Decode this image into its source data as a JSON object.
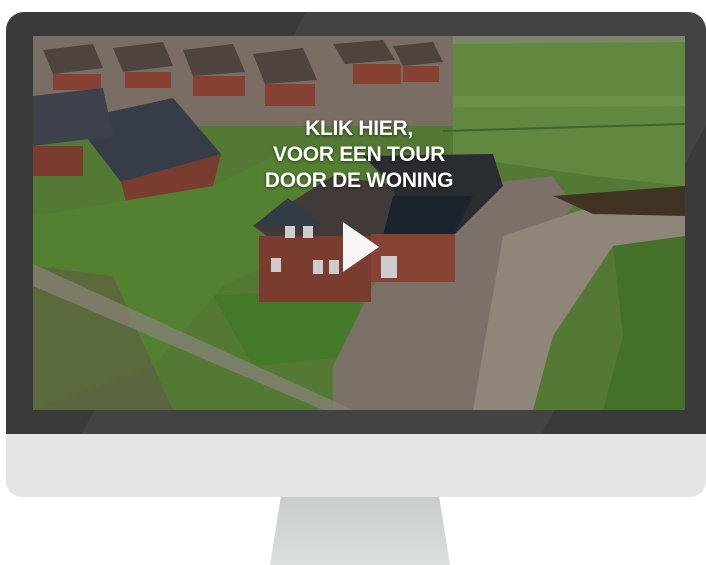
{
  "video": {
    "overlay_lines": [
      "KLIK HIER,",
      "VOOR EEN TOUR",
      "DOOR DE WONING"
    ],
    "play_icon": "play-icon"
  },
  "colors": {
    "bezel": "#3a3a3a",
    "chin": "#e4e6e6",
    "stand": "#cfd2d2",
    "overlay_text": "#ffffff"
  }
}
